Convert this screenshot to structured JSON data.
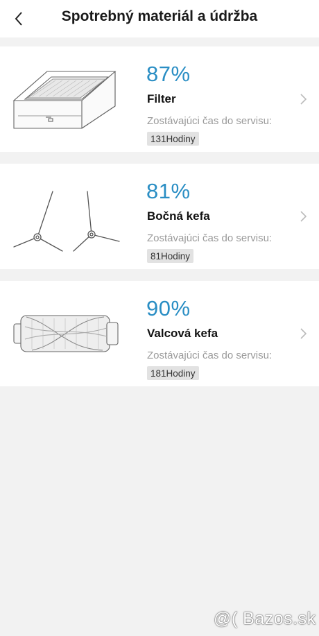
{
  "header": {
    "back_icon": "chevron-left-icon",
    "title": "Spotrebný materiál a údržba"
  },
  "items": [
    {
      "percent": "87%",
      "name": "Filter",
      "remaining_label": "Zostávajúci čas do servisu:",
      "hours": "131Hodiny",
      "image_icon": "filter-icon"
    },
    {
      "percent": "81%",
      "name": "Bočná kefa",
      "remaining_label": "Zostávajúci čas do servisu:",
      "hours": "81Hodiny",
      "image_icon": "side-brush-icon"
    },
    {
      "percent": "90%",
      "name": "Valcová kefa",
      "remaining_label": "Zostávajúci čas do servisu:",
      "hours": "181Hodiny",
      "image_icon": "roller-brush-icon"
    }
  ],
  "watermark": "@( Bazos.sk",
  "colors": {
    "accent": "#2a8ec4",
    "background": "#f2f2f2",
    "card": "#ffffff",
    "badge": "#e2e2e2"
  }
}
